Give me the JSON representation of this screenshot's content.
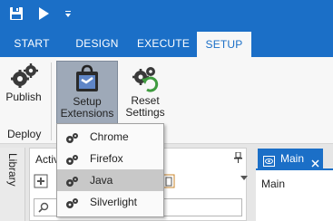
{
  "quick_access": {
    "save_icon": "save-icon",
    "run_icon": "play-icon",
    "menu_icon": "customize-dropdown-icon"
  },
  "tabs": [
    {
      "label": "START"
    },
    {
      "label": "DESIGN"
    },
    {
      "label": "EXECUTE"
    },
    {
      "label": "SETUP",
      "active": true
    }
  ],
  "ribbon": {
    "publish_label": "Publish",
    "setup_ext_line1": "Setup",
    "setup_ext_line2": "Extensions",
    "reset_line1": "Reset",
    "reset_line2": "Settings",
    "group_label": "Deploy"
  },
  "dropdown": {
    "items": [
      {
        "label": "Chrome"
      },
      {
        "label": "Firefox"
      },
      {
        "label": "Java",
        "hovered": true
      },
      {
        "label": "Silverlight"
      }
    ]
  },
  "side": {
    "library_label": "Library"
  },
  "activities": {
    "title": "Activ",
    "search_icon": "search-icon"
  },
  "document": {
    "tab_label": "Main",
    "body_label": "Main"
  },
  "colors": {
    "accent": "#1b6fc7",
    "ribbon": "#f7f7f7",
    "pressed": "#9ea9b8"
  }
}
